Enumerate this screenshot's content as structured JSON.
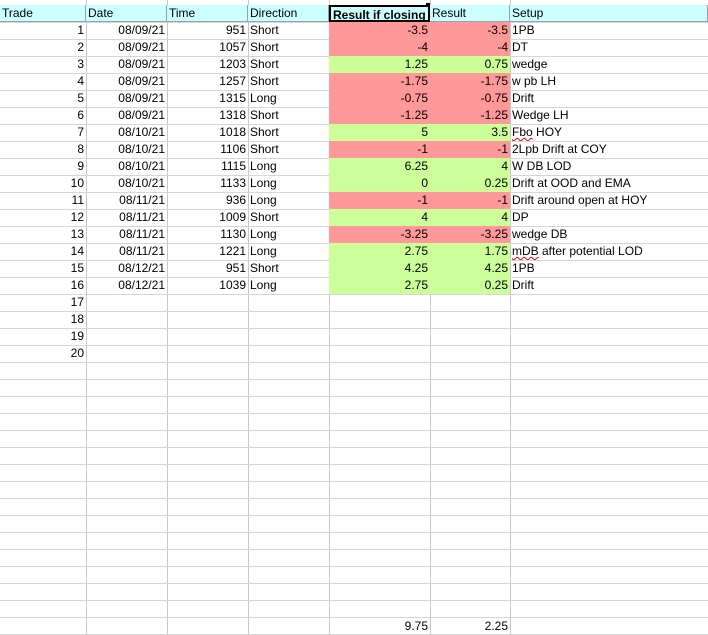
{
  "headers": [
    "Trade",
    "Date",
    "Time",
    "Direction",
    "Result if closing",
    "Result",
    "Setup"
  ],
  "rows": [
    {
      "trade": "1",
      "date": "08/09/21",
      "time": "951",
      "dir": "Short",
      "ric": "-3.5",
      "res": "-3.5",
      "setup": "1PB",
      "color": "red"
    },
    {
      "trade": "2",
      "date": "08/09/21",
      "time": "1057",
      "dir": "Short",
      "ric": "-4",
      "res": "-4",
      "setup": "DT",
      "color": "red"
    },
    {
      "trade": "3",
      "date": "08/09/21",
      "time": "1203",
      "dir": "Short",
      "ric": "1.25",
      "res": "0.75",
      "setup": "wedge",
      "color": "green"
    },
    {
      "trade": "4",
      "date": "08/09/21",
      "time": "1257",
      "dir": "Short",
      "ric": "-1.75",
      "res": "-1.75",
      "setup": "w pb LH",
      "color": "red"
    },
    {
      "trade": "5",
      "date": "08/09/21",
      "time": "1315",
      "dir": "Long",
      "ric": "-0.75",
      "res": "-0.75",
      "setup": "Drift",
      "color": "red"
    },
    {
      "trade": "6",
      "date": "08/09/21",
      "time": "1318",
      "dir": "Short",
      "ric": "-1.25",
      "res": "-1.25",
      "setup": "Wedge LH",
      "color": "red"
    },
    {
      "trade": "7",
      "date": "08/10/21",
      "time": "1018",
      "dir": "Short",
      "ric": "5",
      "res": "3.5",
      "setup": "Fbo HOY",
      "color": "green"
    },
    {
      "trade": "8",
      "date": "08/10/21",
      "time": "1106",
      "dir": "Short",
      "ric": "-1",
      "res": "-1",
      "setup": "2Lpb Drift at COY",
      "color": "red"
    },
    {
      "trade": "9",
      "date": "08/10/21",
      "time": "1115",
      "dir": "Long",
      "ric": "6.25",
      "res": "4",
      "setup": "W DB LOD",
      "color": "green"
    },
    {
      "trade": "10",
      "date": "08/10/21",
      "time": "1133",
      "dir": "Long",
      "ric": "0",
      "res": "0.25",
      "setup": "Drift at OOD and EMA",
      "color": "green"
    },
    {
      "trade": "11",
      "date": "08/11/21",
      "time": "936",
      "dir": "Long",
      "ric": "-1",
      "res": "-1",
      "setup": "Drift around open at HOY",
      "color": "red"
    },
    {
      "trade": "12",
      "date": "08/11/21",
      "time": "1009",
      "dir": "Short",
      "ric": "4",
      "res": "4",
      "setup": "DP",
      "color": "green"
    },
    {
      "trade": "13",
      "date": "08/11/21",
      "time": "1130",
      "dir": "Long",
      "ric": "-3.25",
      "res": "-3.25",
      "setup": "wedge DB",
      "color": "red"
    },
    {
      "trade": "14",
      "date": "08/11/21",
      "time": "1221",
      "dir": "Long",
      "ric": "2.75",
      "res": "1.75",
      "setup": "mDB after potential LOD",
      "color": "green"
    },
    {
      "trade": "15",
      "date": "08/12/21",
      "time": "951",
      "dir": "Short",
      "ric": "4.25",
      "res": "4.25",
      "setup": "1PB",
      "color": "green"
    },
    {
      "trade": "16",
      "date": "08/12/21",
      "time": "1039",
      "dir": "Long",
      "ric": "2.75",
      "res": "0.25",
      "setup": "Drift",
      "color": "green"
    }
  ],
  "empty_trades": [
    "17",
    "18",
    "19",
    "20"
  ],
  "totals": {
    "ric": "9.75",
    "res": "2.25"
  },
  "colors": {
    "header_bg": "#ccffff",
    "loss_bg": "#ff9999",
    "win_bg": "#ccff99",
    "grid": "#d6d6d6"
  }
}
